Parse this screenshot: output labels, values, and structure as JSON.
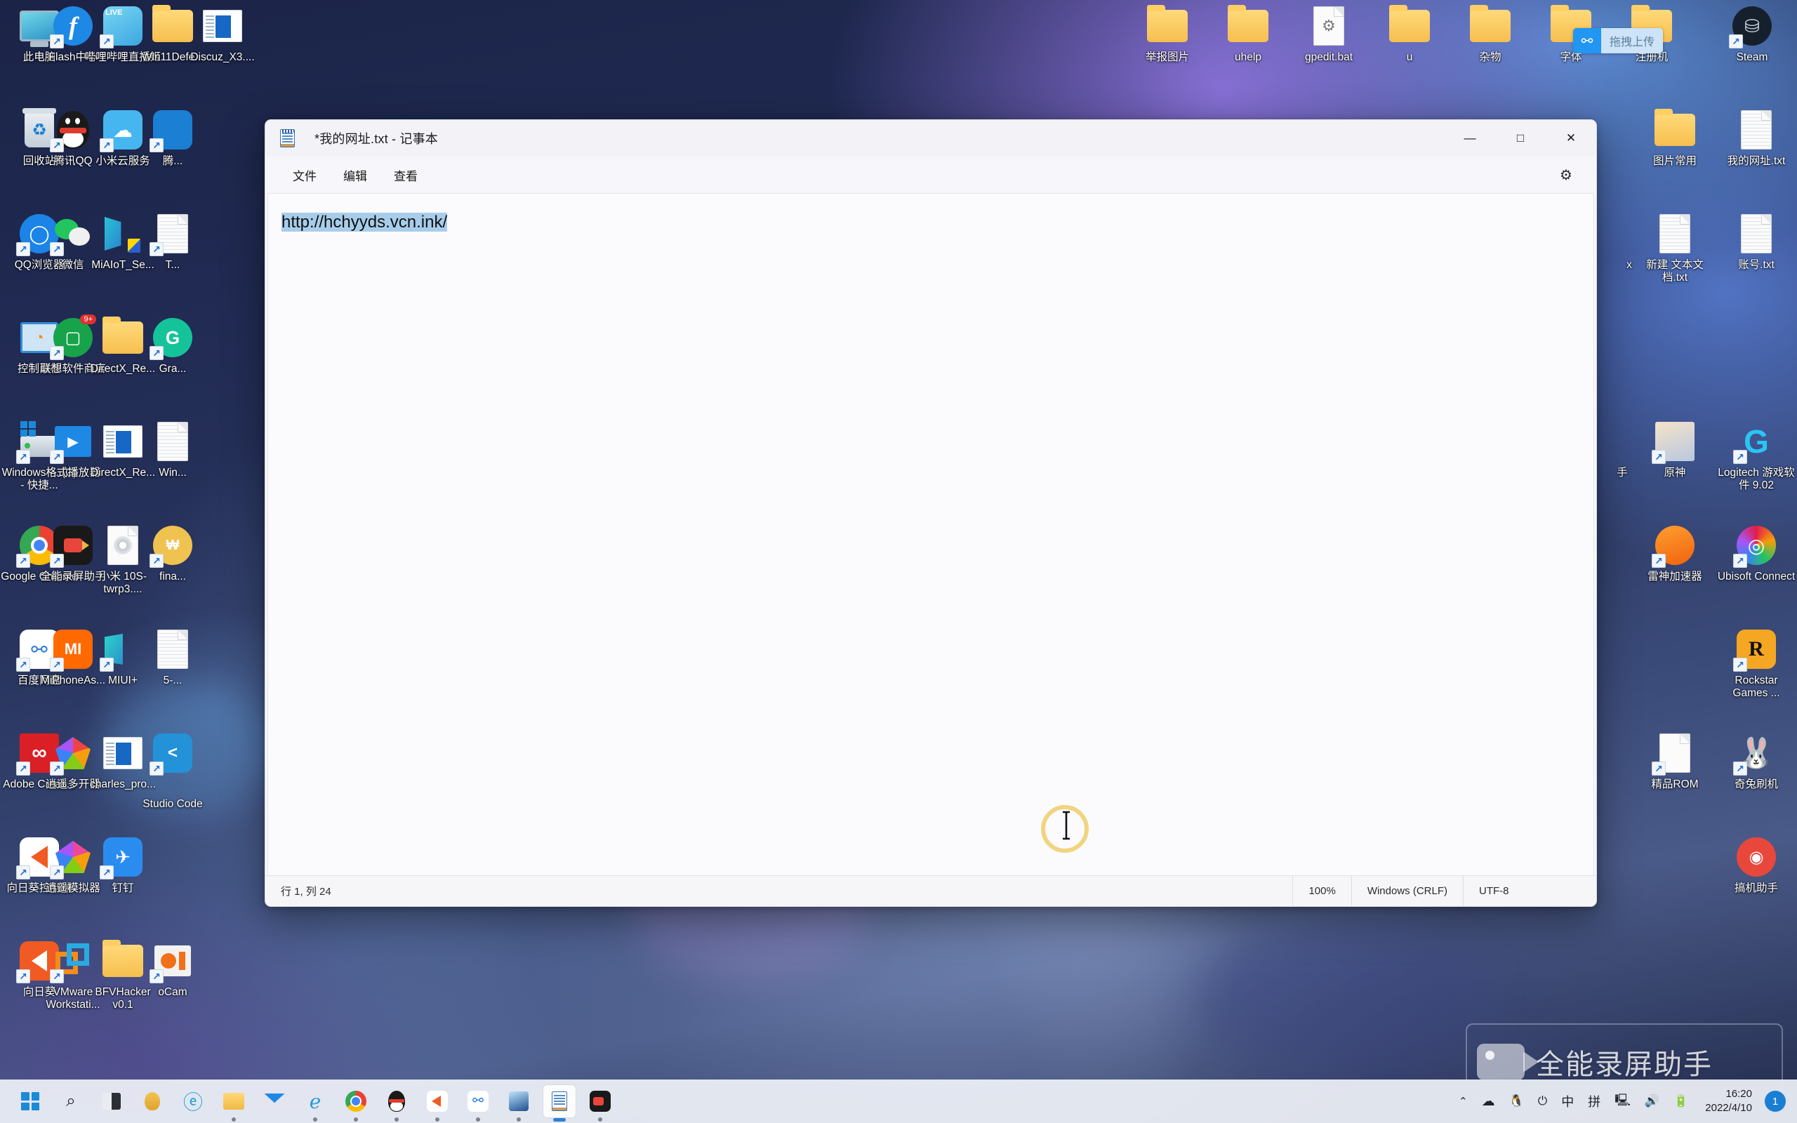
{
  "desktop": {
    "icons_left": [
      {
        "label": "此电脑",
        "icon": "this-pc-icon",
        "shortcut": false
      },
      {
        "label": "Flash中心",
        "icon": "flash-icon",
        "shortcut": true
      },
      {
        "label": "哔哩哔哩直播姬",
        "icon": "bilibili-live-icon",
        "shortcut": true
      },
      {
        "label": "Win11Defe...",
        "icon": "folder-icon",
        "shortcut": false
      },
      {
        "label": "Discuz_X3....",
        "icon": "document-window-icon",
        "shortcut": false
      },
      {
        "label": "回收站",
        "icon": "recycle-bin-icon",
        "shortcut": false
      },
      {
        "label": "腾讯QQ",
        "icon": "qq-penguin-icon",
        "shortcut": true
      },
      {
        "label": "小米云服务",
        "icon": "mi-cloud-icon",
        "shortcut": true
      },
      {
        "label": "腾...",
        "icon": "tencent-icon",
        "shortcut": true
      },
      {
        "label": "QQ浏览器",
        "icon": "qq-browser-icon",
        "shortcut": true
      },
      {
        "label": "微信",
        "icon": "wechat-icon",
        "shortcut": true
      },
      {
        "label": "MiAIoT_Se...",
        "icon": "miaiot-icon",
        "shortcut": false
      },
      {
        "label": "T...",
        "icon": "tool-icon",
        "shortcut": true
      },
      {
        "label": "控制面板",
        "icon": "control-panel-icon",
        "shortcut": false
      },
      {
        "label": "联想软件商店",
        "icon": "lenovo-store-icon",
        "shortcut": true,
        "badge": "9+"
      },
      {
        "label": "DirectX_Re...",
        "icon": "folder-icon",
        "shortcut": false
      },
      {
        "label": "Gra...",
        "icon": "grammarly-icon",
        "shortcut": true
      },
      {
        "label": "Windows-... (C) - 快捷...",
        "icon": "windows-drive-icon",
        "shortcut": true
      },
      {
        "label": "格式播放器",
        "icon": "format-player-icon",
        "shortcut": true
      },
      {
        "label": "DirectX_Re...",
        "icon": "document-window-icon",
        "shortcut": false
      },
      {
        "label": "Win...",
        "icon": "winrar-file-icon",
        "shortcut": false
      },
      {
        "label": "Google Chrome",
        "icon": "chrome-icon",
        "shortcut": true
      },
      {
        "label": "全能录屏助手",
        "icon": "screen-recorder-icon",
        "shortcut": true
      },
      {
        "label": "小米 10S-twrp3....",
        "icon": "disc-file-icon",
        "shortcut": false
      },
      {
        "label": "fina...",
        "icon": "finance-icon",
        "shortcut": true
      },
      {
        "label": "百度网盘",
        "icon": "baidu-netdisk-icon",
        "shortcut": true
      },
      {
        "label": "MiPhoneAs...",
        "icon": "mi-phone-assistant-icon",
        "shortcut": true
      },
      {
        "label": "MIUI+",
        "icon": "miui-plus-icon",
        "shortcut": true
      },
      {
        "label": "5-...",
        "icon": "file-icon",
        "shortcut": false
      },
      {
        "label": "Adobe Creati...",
        "icon": "adobe-cc-icon",
        "shortcut": true
      },
      {
        "label": "逍遥多开器",
        "icon": "memu-multi-icon",
        "shortcut": true
      },
      {
        "label": "charles_pro...",
        "icon": "document-window-icon",
        "shortcut": false
      },
      {
        "label": "Studio Code",
        "icon": "vscode-icon",
        "shortcut": true
      },
      {
        "label": "向日葵控制端",
        "icon": "sunlogin-control-icon",
        "shortcut": true
      },
      {
        "label": "逍遥模拟器",
        "icon": "memu-emulator-icon",
        "shortcut": true
      },
      {
        "label": "钉钉",
        "icon": "dingtalk-icon",
        "shortcut": true
      },
      {
        "label": "向日葵",
        "icon": "sunlogin-icon",
        "shortcut": true
      },
      {
        "label": "VMware Workstati...",
        "icon": "vmware-icon",
        "shortcut": true
      },
      {
        "label": "BFVHacker v0.1",
        "icon": "folder-icon",
        "shortcut": false
      },
      {
        "label": "oCam",
        "icon": "ocam-icon",
        "shortcut": true
      }
    ],
    "icons_top_right": [
      {
        "label": "举报图片",
        "icon": "folder-icon",
        "shortcut": false
      },
      {
        "label": "uhelp",
        "icon": "folder-icon",
        "shortcut": false
      },
      {
        "label": "gpedit.bat",
        "icon": "bat-script-icon",
        "shortcut": false
      },
      {
        "label": "u",
        "icon": "folder-icon",
        "shortcut": false
      },
      {
        "label": "杂物",
        "icon": "folder-icon",
        "shortcut": false
      },
      {
        "label": "字体",
        "icon": "folder-icon",
        "shortcut": false
      },
      {
        "label": "注册机",
        "icon": "folder-icon",
        "shortcut": false
      },
      {
        "label": "Steam",
        "icon": "steam-icon",
        "shortcut": true
      }
    ],
    "icons_right": [
      {
        "label": "图片常用",
        "icon": "folder-icon",
        "shortcut": false
      },
      {
        "label": "我的网址.txt",
        "icon": "text-file-icon",
        "shortcut": false
      },
      {
        "label": "x",
        "icon": "file-icon",
        "shortcut": false
      },
      {
        "label": "新建 文本文档.txt",
        "icon": "text-file-icon",
        "shortcut": false
      },
      {
        "label": "账号.txt",
        "icon": "text-file-icon",
        "shortcut": false
      },
      {
        "label": "手",
        "icon": "assistant-icon",
        "shortcut": false
      },
      {
        "label": "原神",
        "icon": "genshin-impact-icon",
        "shortcut": true
      },
      {
        "label": "Logitech 游戏软件 9.02",
        "icon": "logitech-icon",
        "shortcut": true
      },
      {
        "label": "雷神加速器",
        "icon": "leishen-accelerator-icon",
        "shortcut": true
      },
      {
        "label": "Ubisoft Connect",
        "icon": "ubisoft-icon",
        "shortcut": true
      },
      {
        "label": "Rockstar Games ...",
        "icon": "rockstar-games-icon",
        "shortcut": true
      },
      {
        "label": "精品ROM",
        "icon": "file-icon",
        "shortcut": true
      },
      {
        "label": "奇兔刷机",
        "icon": "qitu-flash-icon",
        "shortcut": true
      },
      {
        "label": "搞机助手",
        "icon": "gaoji-assistant-icon",
        "shortcut": true
      }
    ],
    "upload_badge": {
      "label": "拖拽上传",
      "icon": "baidu-netdisk-icon",
      "accent": "#2196f3"
    },
    "watermark": {
      "text": "全能录屏助手",
      "icon": "video-camera-icon"
    }
  },
  "notepad": {
    "title": "*我的网址.txt - 记事本",
    "icon": "notepad-icon",
    "menus": [
      {
        "label": "文件",
        "name": "menu-file"
      },
      {
        "label": "编辑",
        "name": "menu-edit"
      },
      {
        "label": "查看",
        "name": "menu-view"
      }
    ],
    "window_buttons": {
      "minimize": "—",
      "maximize": "□",
      "close": "✕"
    },
    "settings_icon": "gear-icon",
    "content": {
      "text": "http://hchyyds.vcn.ink/",
      "selected": true,
      "selection_color": "#a8cdeb"
    },
    "status": {
      "position": "行 1, 列 24",
      "zoom": "100%",
      "line_ending": "Windows (CRLF)",
      "encoding": "UTF-8"
    }
  },
  "taskbar": {
    "items": [
      {
        "name": "start-button",
        "icon": "windows-logo-icon",
        "running": false
      },
      {
        "name": "search-button",
        "icon": "search-icon",
        "running": false
      },
      {
        "name": "task-view-button",
        "icon": "task-view-icon",
        "running": false
      },
      {
        "name": "widgets-button",
        "icon": "widgets-icon",
        "running": false
      },
      {
        "name": "edge-button",
        "icon": "edge-icon",
        "running": false
      },
      {
        "name": "file-explorer-button",
        "icon": "file-explorer-icon",
        "running": true
      },
      {
        "name": "mail-button",
        "icon": "mail-icon",
        "running": false
      },
      {
        "name": "edge-legacy-button",
        "icon": "edge-legacy-icon",
        "running": true
      },
      {
        "name": "chrome-button",
        "icon": "chrome-icon",
        "running": true
      },
      {
        "name": "qq-button",
        "icon": "qq-penguin-icon",
        "running": true
      },
      {
        "name": "sunlogin-button",
        "icon": "sunlogin-icon",
        "running": true
      },
      {
        "name": "baidu-netdisk-button",
        "icon": "baidu-netdisk-icon",
        "running": true
      },
      {
        "name": "photos-button",
        "icon": "photos-icon",
        "running": true
      },
      {
        "name": "notepad-button",
        "icon": "notepad-icon",
        "running": true,
        "active": true
      },
      {
        "name": "screen-recorder-button",
        "icon": "screen-recorder-icon",
        "running": true
      }
    ],
    "tray": [
      {
        "name": "show-hidden-icons",
        "icon": "chevron-up-icon",
        "glyph": "⌃"
      },
      {
        "name": "onedrive-icon",
        "icon": "cloud-icon",
        "glyph": "☁"
      },
      {
        "name": "qq-tray-icon",
        "icon": "qq-penguin-icon",
        "glyph": "🐧"
      },
      {
        "name": "microphone-icon",
        "icon": "microphone-icon",
        "glyph": "🎙"
      },
      {
        "name": "ime-mode",
        "icon": "ime-chinese-icon",
        "glyph": "中"
      },
      {
        "name": "ime-pinyin",
        "icon": "ime-pinyin-icon",
        "glyph": "拼"
      },
      {
        "name": "network-icon",
        "icon": "network-icon",
        "glyph": "🖥"
      },
      {
        "name": "volume-icon",
        "icon": "speaker-icon",
        "glyph": "🔊"
      },
      {
        "name": "battery-icon",
        "icon": "battery-icon",
        "glyph": "🔋"
      }
    ],
    "clock": {
      "time": "16:20",
      "date": "2022/4/10"
    },
    "notification_count": "1"
  }
}
